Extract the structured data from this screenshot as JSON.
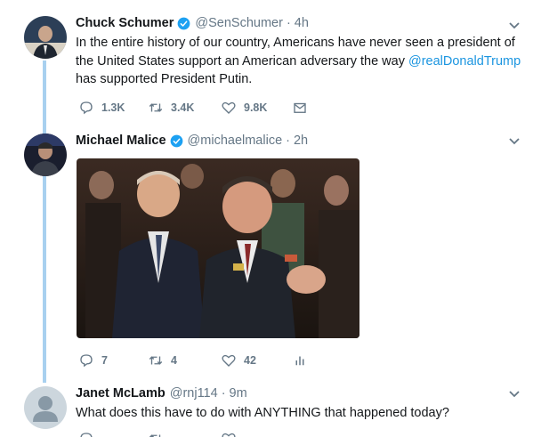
{
  "tweets": [
    {
      "name": "Chuck Schumer",
      "handle": "@SenSchumer",
      "time": "4h",
      "text_before": "In the entire history of our country, Americans have never seen a president of the United States support an American adversary the way ",
      "mention": "@realDonaldTrump",
      "text_after": " has supported President Putin.",
      "replies": "1.3K",
      "retweets": "3.4K",
      "likes": "9.8K"
    },
    {
      "name": "Michael Malice",
      "handle": "@michaelmalice",
      "time": "2h",
      "replies": "7",
      "retweets": "4",
      "likes": "42"
    },
    {
      "name": "Janet McLamb",
      "handle": "@rnj114",
      "time": "9m",
      "text": "What does this have to do with ANYTHING that happened today?"
    }
  ],
  "icons": {
    "verified": "verified-badge-icon",
    "reply": "reply-icon",
    "retweet": "retweet-icon",
    "like": "heart-icon",
    "dm": "direct-message-icon",
    "analytics": "analytics-icon",
    "more": "chevron-down-icon"
  },
  "colors": {
    "accent": "#1b95e0",
    "thread_line": "#a8d0ef",
    "muted": "#657786"
  }
}
